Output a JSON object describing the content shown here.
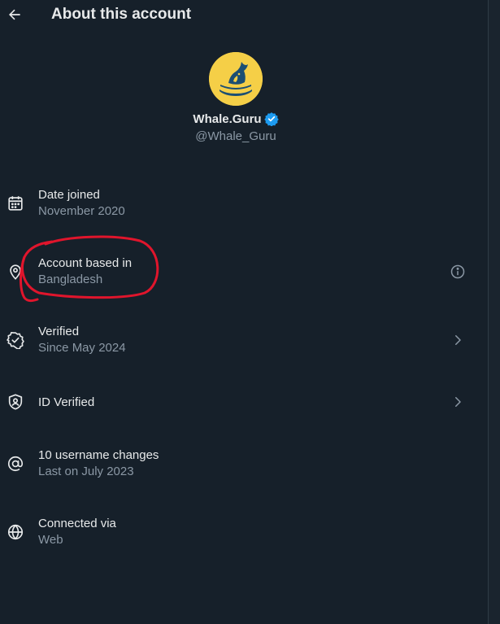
{
  "header": {
    "back_icon": "arrow-left-icon",
    "title": "About this account"
  },
  "profile": {
    "avatar_icon": "whale-logo",
    "avatar_color": "#f5cf47",
    "display_name": "Whale.Guru",
    "verified_icon": "verified-badge-icon",
    "verified_color": "#1d9bf0",
    "handle": "@Whale_Guru"
  },
  "details": [
    {
      "icon": "calendar-icon",
      "label": "Date joined",
      "value": "November 2020"
    },
    {
      "icon": "location-pin-icon",
      "label": "Account based in",
      "value": "Bangladesh",
      "trailing_icon": "info-icon"
    },
    {
      "icon": "verified-check-icon",
      "label": "Verified",
      "value": "Since May 2024",
      "trailing_icon": "chevron-right-icon"
    },
    {
      "icon": "shield-user-icon",
      "label": "ID Verified",
      "trailing_icon": "chevron-right-icon"
    },
    {
      "icon": "at-sign-icon",
      "label": "10 username changes",
      "value": "Last on July 2023"
    },
    {
      "icon": "globe-icon",
      "label": "Connected via",
      "value": "Web"
    }
  ],
  "annotation": {
    "shape": "hand-drawn circle",
    "color": "#e0152c",
    "target": "Account based in"
  },
  "colors": {
    "background": "#16202a",
    "primary_text": "#e7e9ea",
    "secondary_text": "#8b98a5"
  }
}
